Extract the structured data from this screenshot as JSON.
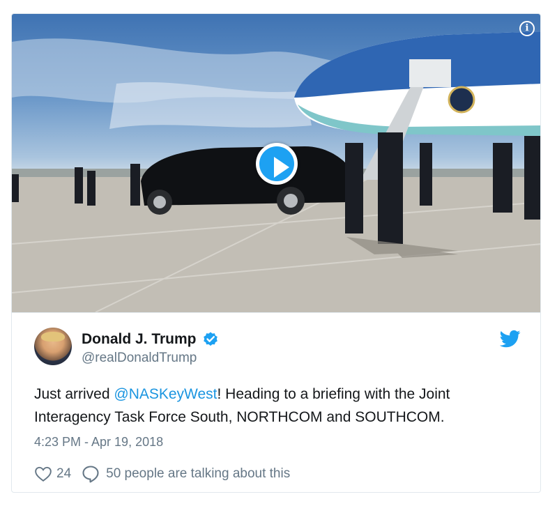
{
  "media": {
    "type": "video",
    "info_icon": "info-icon",
    "play_icon": "play-icon"
  },
  "tweet": {
    "author_name": "Donald J. Trump",
    "handle": "@realDonaldTrump",
    "verified_icon": "verified-badge-icon",
    "brand_icon": "twitter-bird-icon",
    "text_before": "Just arrived ",
    "mention": "@NASKeyWest",
    "text_after": "! Heading to a briefing with the Joint Interagency Task Force South, NORTHCOM and SOUTHCOM.",
    "timestamp": "4:23 PM - Apr 19, 2018",
    "likes": "24",
    "talking": "50 people are talking about this"
  },
  "colors": {
    "accent": "#1da1f2",
    "mention": "#1b95e0",
    "secondary_text": "#657786",
    "border": "#e1e8ed"
  }
}
